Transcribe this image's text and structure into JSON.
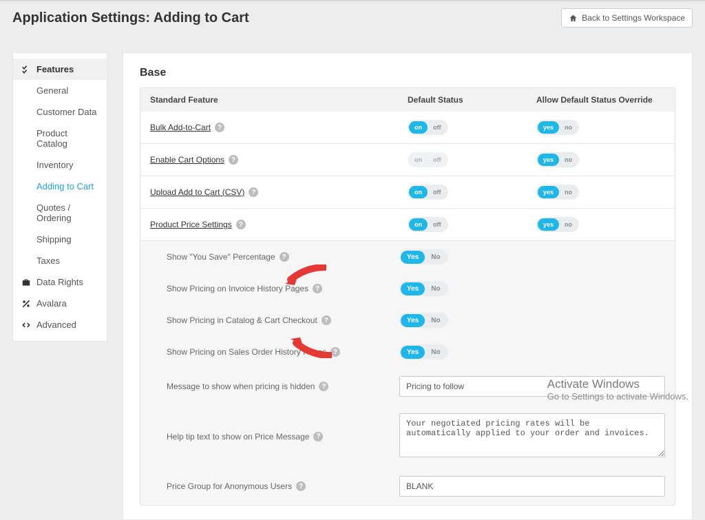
{
  "header": {
    "title": "Application Settings: Adding to Cart",
    "back_label": "Back to Settings Workspace"
  },
  "sidebar": {
    "items": [
      {
        "label": "Features"
      },
      {
        "label": "General"
      },
      {
        "label": "Customer Data"
      },
      {
        "label": "Product Catalog"
      },
      {
        "label": "Inventory"
      },
      {
        "label": "Adding to Cart"
      },
      {
        "label": "Quotes / Ordering"
      },
      {
        "label": "Shipping"
      },
      {
        "label": "Taxes"
      },
      {
        "label": "Data Rights"
      },
      {
        "label": "Avalara"
      },
      {
        "label": "Advanced"
      }
    ]
  },
  "section": {
    "title": "Base"
  },
  "columns": {
    "a": "Standard Feature",
    "b": "Default Status",
    "c": "Allow Default Status Override"
  },
  "toggle": {
    "on": "on",
    "off": "off",
    "yes": "yes",
    "no": "no",
    "Yes": "Yes",
    "No": "No"
  },
  "features": {
    "bulk": "Bulk Add-to-Cart",
    "enableCart": "Enable Cart Options",
    "uploadCsv": "Upload Add to Cart (CSV)",
    "priceSettings": "Product Price Settings"
  },
  "subs": {
    "youSave": "Show \"You Save\" Percentage",
    "invoiceHist": "Show Pricing on Invoice History Pages",
    "catalogCheckout": "Show Pricing in Catalog & Cart Checkout",
    "salesOrder": "Show Pricing on Sales Order History Pages",
    "hiddenMsg": "Message to show when pricing is hidden",
    "helpTip": "Help tip text to show on Price Message",
    "priceGroup": "Price Group for Anonymous Users"
  },
  "values": {
    "hiddenMsg": "Pricing to follow",
    "helpTip": "Your negotiated pricing rates will be automatically applied to your order and invoices.",
    "priceGroup": "BLANK"
  },
  "watermark": {
    "line1": "Activate Windows",
    "line2": "Go to Settings to activate Windows."
  }
}
